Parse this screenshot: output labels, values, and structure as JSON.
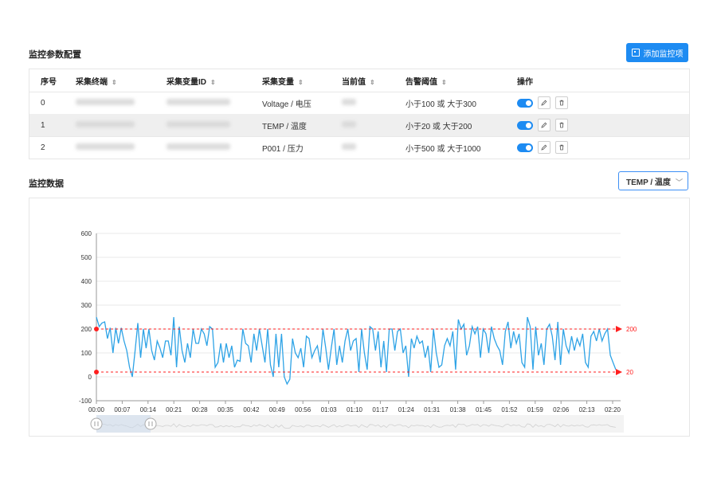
{
  "config_section": {
    "title": "监控参数配置",
    "add_button": "添加监控项"
  },
  "table": {
    "headers": [
      "序号",
      "采集终端",
      "采集变量ID",
      "采集变量",
      "当前值",
      "告警阈值",
      "操作"
    ],
    "sortable": [
      false,
      true,
      true,
      true,
      true,
      true,
      false
    ],
    "rows": [
      {
        "index": "0",
        "variable": "Voltage / 电压",
        "threshold": "小于100 或 大于300",
        "enabled": true
      },
      {
        "index": "1",
        "variable": "TEMP / 温度",
        "threshold": "小于20 或 大于200",
        "enabled": true
      },
      {
        "index": "2",
        "variable": "P001 / 压力",
        "threshold": "小于500 或 大于1000",
        "enabled": true
      }
    ]
  },
  "data_section": {
    "title": "监控数据",
    "selected_variable": "TEMP / 温度"
  },
  "colors": {
    "accent": "#1d8bf2",
    "line": "#2ea3e6",
    "threshold": "#ff1f1f"
  },
  "chart_data": {
    "type": "line",
    "xlabel": "",
    "ylabel": "",
    "ylim": [
      -100,
      600
    ],
    "yticks": [
      -100,
      0,
      100,
      200,
      300,
      400,
      500,
      600
    ],
    "xticks": [
      "00:00",
      "00:07",
      "00:14",
      "00:21",
      "00:28",
      "00:35",
      "00:42",
      "00:49",
      "00:56",
      "01:03",
      "01:10",
      "01:17",
      "01:24",
      "01:31",
      "01:38",
      "01:45",
      "01:52",
      "01:59",
      "02:06",
      "02:13",
      "02:20"
    ],
    "grid": true,
    "thresholds": [
      {
        "value": 200,
        "label": "200"
      },
      {
        "value": 20,
        "label": "20"
      }
    ],
    "series": [
      {
        "values": [
          250,
          210,
          225,
          230,
          160,
          205,
          100,
          205,
          140,
          205,
          150,
          110,
          40,
          0,
          110,
          225,
          80,
          200,
          120,
          200,
          110,
          70,
          150,
          120,
          80,
          150,
          150,
          90,
          250,
          40,
          210,
          110,
          60,
          140,
          80,
          200,
          140,
          140,
          200,
          180,
          130,
          210,
          200,
          40,
          60,
          140,
          60,
          140,
          80,
          130,
          40,
          70,
          65,
          200,
          140,
          130,
          60,
          180,
          110,
          200,
          130,
          60,
          200,
          50,
          0,
          180,
          40,
          180,
          0,
          -30,
          -10,
          160,
          100,
          80,
          120,
          40,
          170,
          160,
          80,
          110,
          130,
          60,
          200,
          120,
          30,
          120,
          200,
          50,
          130,
          60,
          150,
          200,
          110,
          150,
          160,
          20,
          200,
          100,
          30,
          210,
          200,
          110,
          190,
          40,
          150,
          20,
          200,
          200,
          110,
          190,
          200,
          100,
          130,
          0,
          160,
          120,
          170,
          140,
          150,
          80,
          130,
          20,
          200,
          100,
          40,
          50,
          130,
          160,
          130,
          190,
          30,
          240,
          200,
          220,
          90,
          130,
          210,
          180,
          210,
          80,
          200,
          180,
          100,
          210,
          160,
          130,
          110,
          50,
          190,
          230,
          120,
          190,
          140,
          180,
          60,
          40,
          250,
          210,
          30,
          210,
          90,
          140,
          50,
          200,
          220,
          170,
          70,
          230,
          50,
          200,
          130,
          100,
          170,
          110,
          160,
          130,
          180,
          60,
          40,
          170,
          190,
          150,
          200,
          150,
          180,
          200,
          90,
          60,
          30
        ]
      }
    ]
  }
}
